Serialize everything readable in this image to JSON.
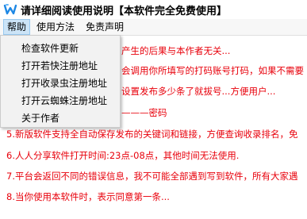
{
  "window": {
    "title": "请详细阅读使用说明【本软件完全免费使用】"
  },
  "menubar": {
    "items": [
      {
        "label": "帮助"
      },
      {
        "label": "使用方法"
      },
      {
        "label": "免责声明"
      }
    ]
  },
  "help_menu": {
    "items": [
      {
        "label": "检查软件更新"
      },
      {
        "label": "打开若快注册地址"
      },
      {
        "label": "打开收录虫注册地址"
      },
      {
        "label": "打开云蜘蛛注册地址"
      },
      {
        "label": "关于作者"
      }
    ]
  },
  "content": {
    "lines": [
      "产生的后果与本作者无关...",
      "会调用你所填写的打码账号打码，如果不需要",
      "设置发布多少条了就拔号...方便用户...",
      "———密码",
      "5.新版软件支持全自动保存发布的关键词和链接，方便查询收录排名，免",
      "6.人人分享软件打开时间:23点-08点，其他时间无法使用.",
      "7.平台会返回不同的错误信息，我不可能全部遇到写到软件，所有大家遇",
      "8.当你使用本软件时，表示同意第一条..."
    ]
  },
  "colors": {
    "text_red": "#e8000b",
    "menu_highlight": "#cce4f7"
  }
}
